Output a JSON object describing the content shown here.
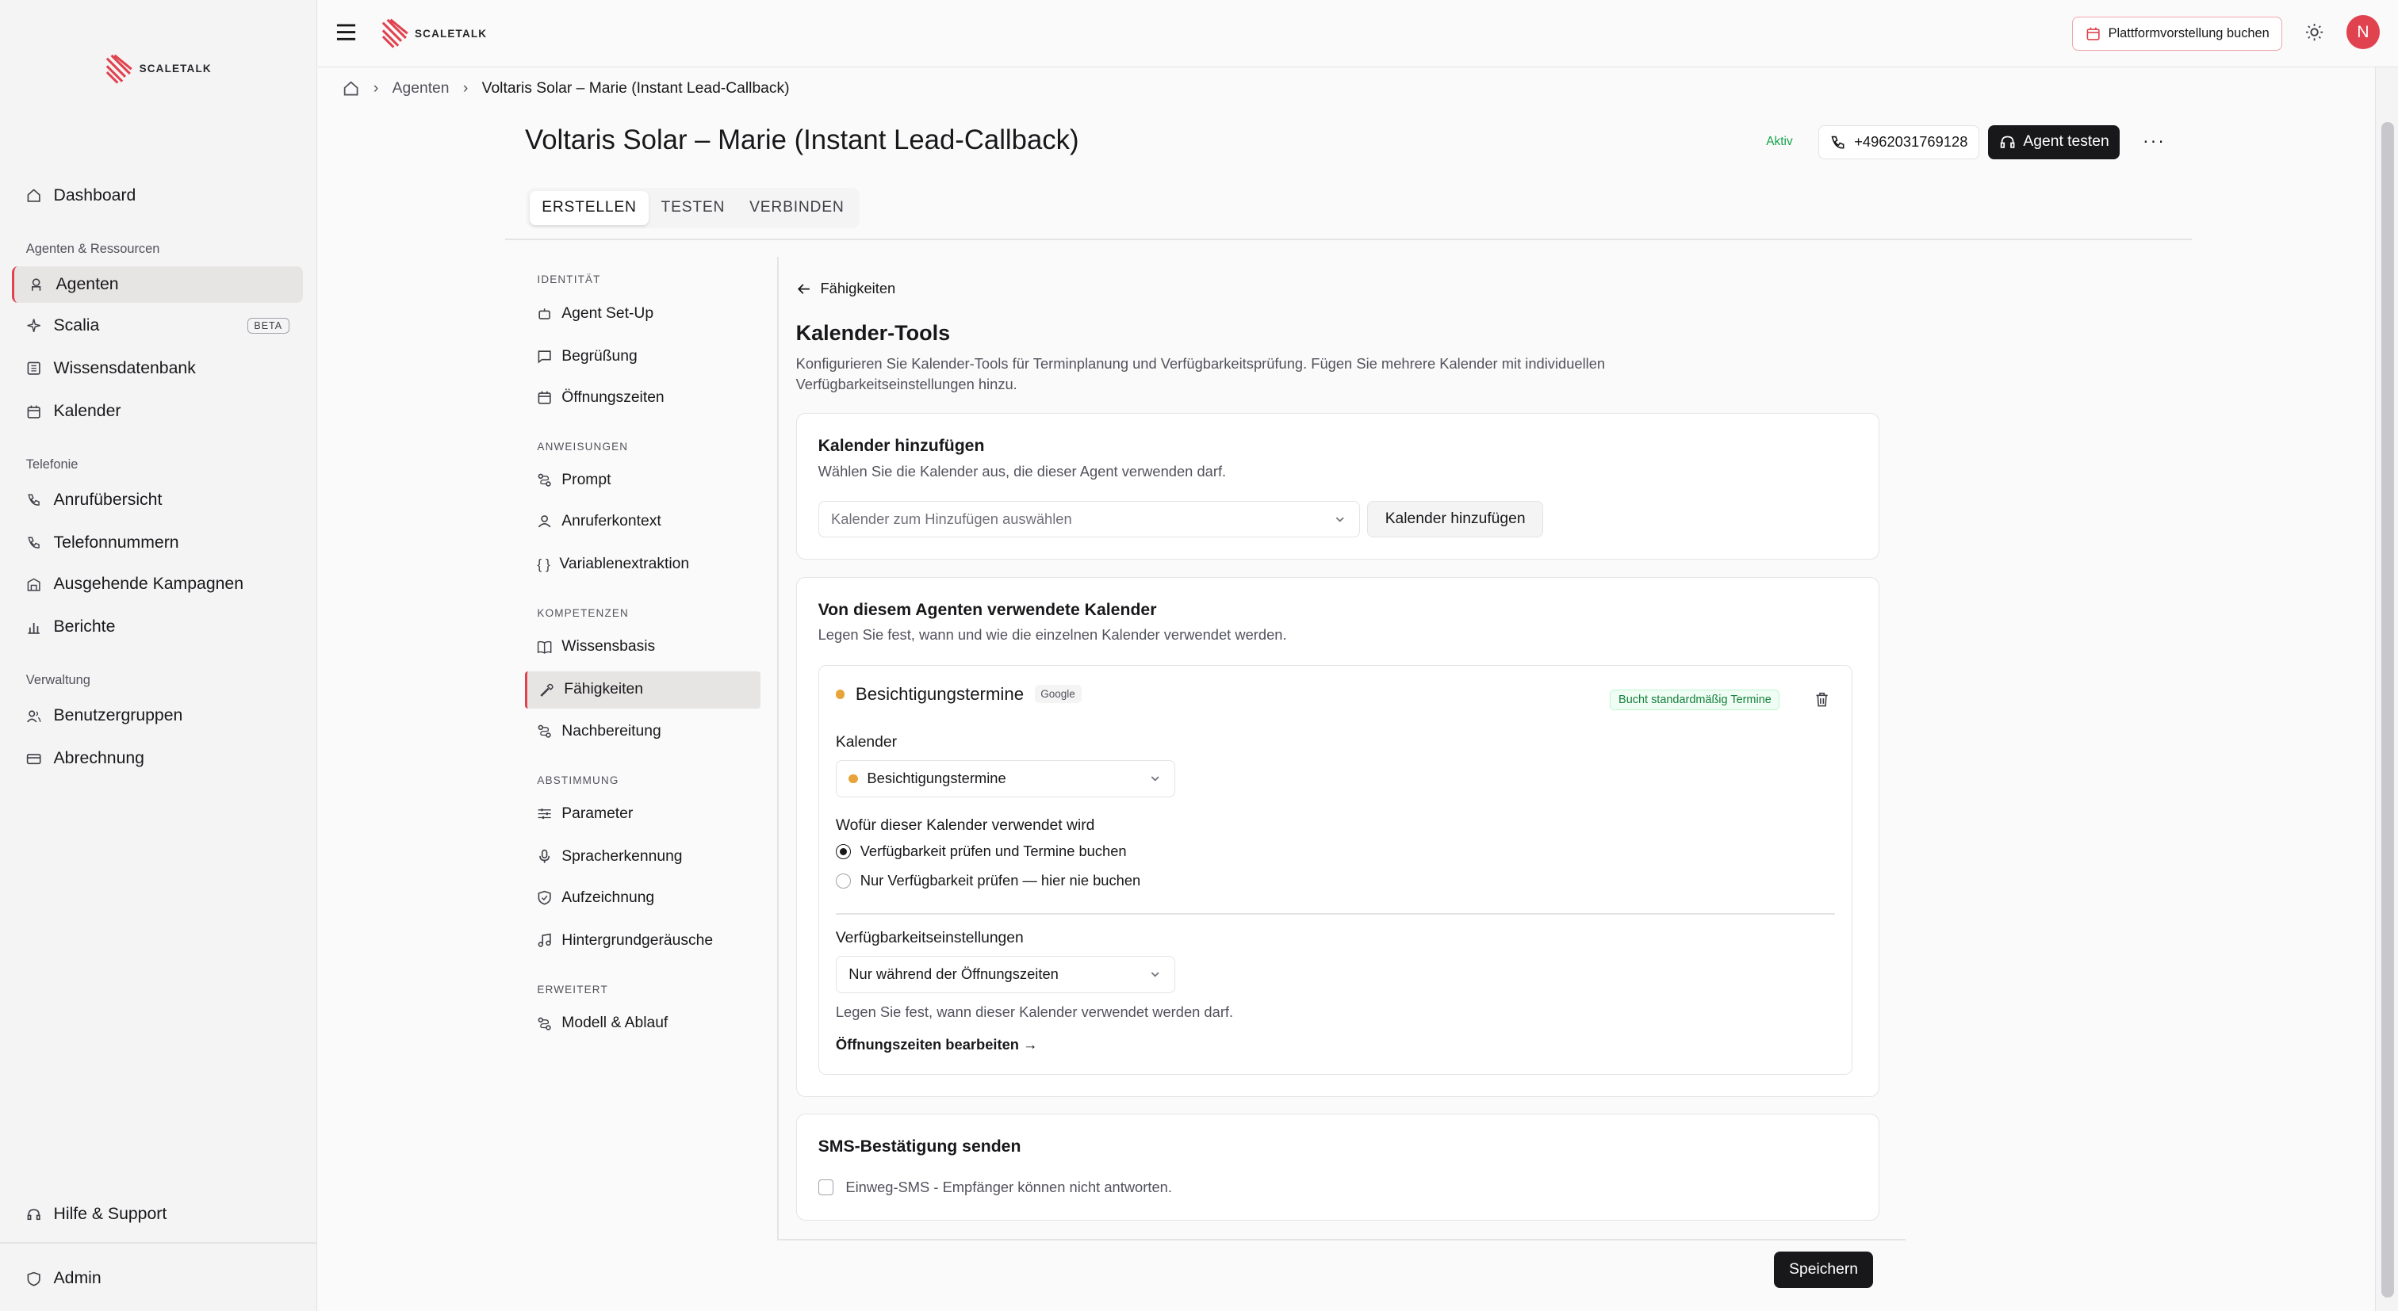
{
  "brand": "SCALETALK",
  "sidebar": {
    "items": [
      {
        "label": "Dashboard",
        "icon": "home-icon"
      },
      {
        "label": "Agenten",
        "icon": "agent-icon"
      },
      {
        "label": "Scalia",
        "icon": "sparkle-icon",
        "badge": "BETA"
      },
      {
        "label": "Wissensdatenbank",
        "icon": "database-icon"
      },
      {
        "label": "Kalender",
        "icon": "calendar-icon"
      },
      {
        "label": "Anrufübersicht",
        "icon": "phone-icon"
      },
      {
        "label": "Telefonnummern",
        "icon": "phone-icon"
      },
      {
        "label": "Ausgehende Kampagnen",
        "icon": "campaign-icon"
      },
      {
        "label": "Berichte",
        "icon": "chart-icon"
      },
      {
        "label": "Benutzergruppen",
        "icon": "users-icon"
      },
      {
        "label": "Abrechnung",
        "icon": "card-icon"
      }
    ],
    "sections": [
      "Agenten & Ressourcen",
      "Telefonie",
      "Verwaltung"
    ],
    "help": "Hilfe & Support",
    "admin": "Admin"
  },
  "header": {
    "demo_button": "Plattformvorstellung buchen",
    "avatar_initial": "N"
  },
  "breadcrumb": {
    "agents": "Agenten",
    "current": "Voltaris Solar – Marie (Instant Lead-Callback)"
  },
  "page": {
    "title": "Voltaris Solar – Marie (Instant Lead-Callback)",
    "status": "Aktiv",
    "phone": "+4962031769128",
    "test_button": "Agent testen",
    "more": "···"
  },
  "tabs": [
    "ERSTELLEN",
    "TESTEN",
    "VERBINDEN"
  ],
  "subnav": {
    "identitaet": {
      "title": "IDENTITÄT",
      "items": [
        "Agent Set-Up",
        "Begrüßung",
        "Öffnungszeiten"
      ]
    },
    "anweisungen": {
      "title": "ANWEISUNGEN",
      "items": [
        "Prompt",
        "Anruferkontext",
        "Variablenextraktion"
      ]
    },
    "kompetenzen": {
      "title": "KOMPETENZEN",
      "items": [
        "Wissensbasis",
        "Fähigkeiten",
        "Nachbereitung"
      ]
    },
    "abstimmung": {
      "title": "ABSTIMMUNG",
      "items": [
        "Parameter",
        "Spracherkennung",
        "Aufzeichnung",
        "Hintergrundgeräusche"
      ]
    },
    "erweitert": {
      "title": "ERWEITERT",
      "items": [
        "Modell & Ablauf"
      ]
    }
  },
  "content": {
    "back_label": "Fähigkeiten",
    "heading": "Kalender-Tools",
    "description": "Konfigurieren Sie Kalender-Tools für Terminplanung und Verfügbarkeitsprüfung. Fügen Sie mehrere Kalender mit individuellen Verfügbarkeitseinstellungen hinzu.",
    "add_card": {
      "title": "Kalender hinzufügen",
      "subtitle": "Wählen Sie die Kalender aus, die dieser Agent verwenden darf.",
      "select_placeholder": "Kalender zum Hinzufügen auswählen",
      "add_button": "Kalender hinzufügen"
    },
    "used_card": {
      "title": "Von diesem Agenten verwendete Kalender",
      "subtitle": "Legen Sie fest, wann und wie die einzelnen Kalender verwendet werden.",
      "calendar": {
        "name": "Besichtigungstermine",
        "provider": "Google",
        "default_badge": "Bucht standardmäßig Termine",
        "dot_color": "#e8a43a",
        "calendar_label": "Kalender",
        "calendar_value": "Besichtigungstermine",
        "usage_label": "Wofür dieser Kalender verwendet wird",
        "usage_options": [
          "Verfügbarkeit prüfen und Termine buchen",
          "Nur Verfügbarkeit prüfen — hier nie buchen"
        ],
        "usage_selected": 0,
        "availability_label": "Verfügbarkeitseinstellungen",
        "availability_value": "Nur während der Öffnungszeiten",
        "availability_help": "Legen Sie fest, wann dieser Kalender verwendet werden darf.",
        "edit_hours_link": "Öffnungszeiten bearbeiten →"
      }
    },
    "sms_card": {
      "title": "SMS-Bestätigung senden",
      "checkbox_label": "Einweg-SMS - Empfänger können nicht antworten.",
      "checked": false
    },
    "save_button": "Speichern"
  },
  "colors": {
    "accent": "#e0434f",
    "primary": "#18181b",
    "success": "#16a34a"
  }
}
